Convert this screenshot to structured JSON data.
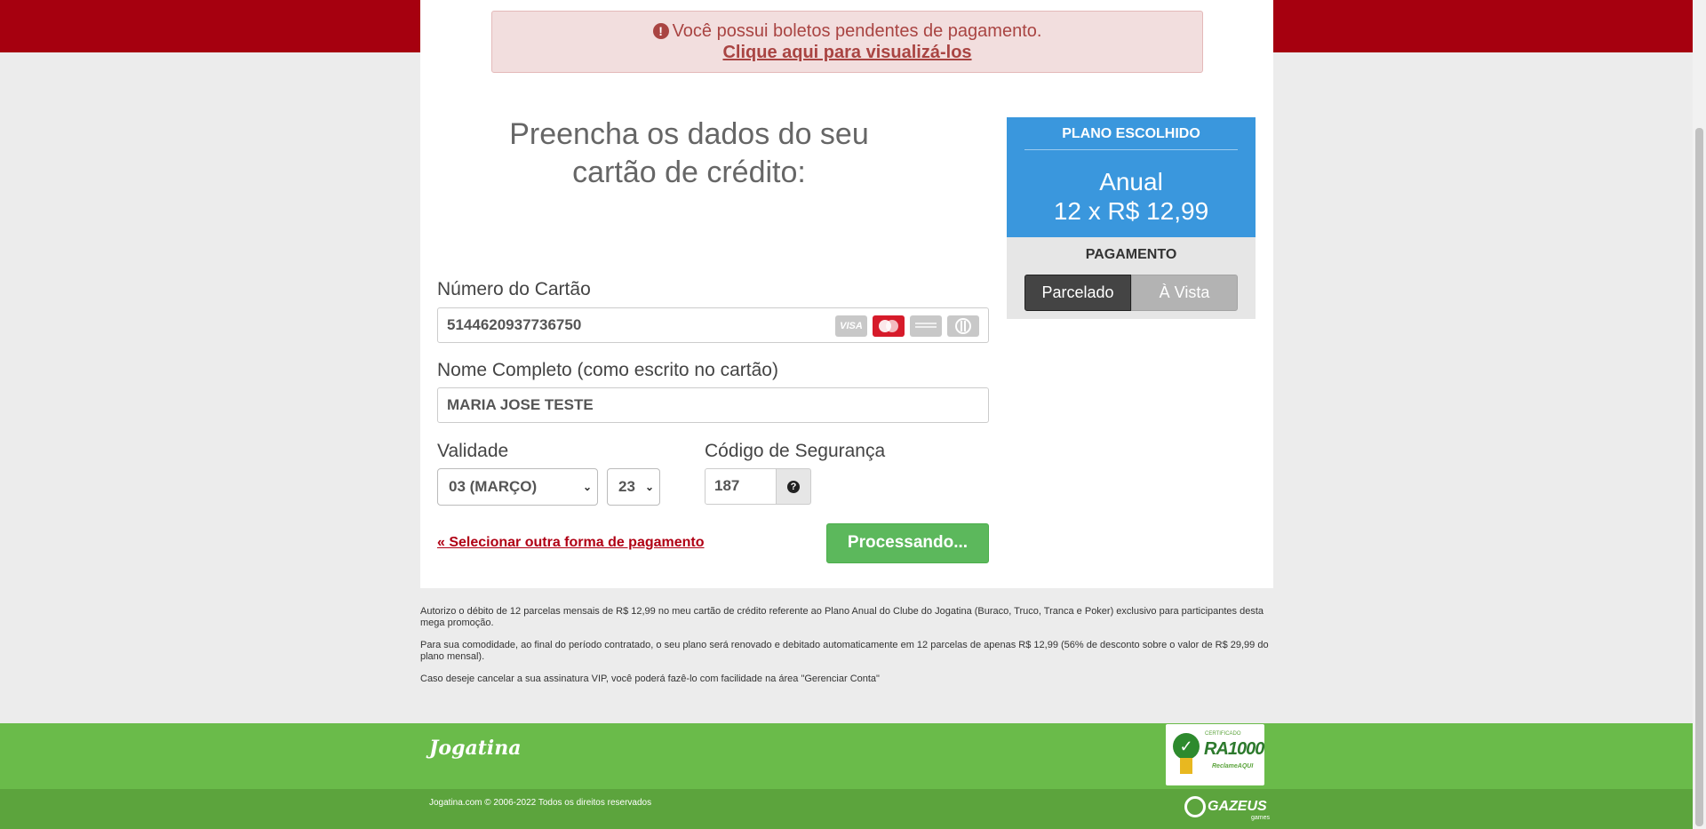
{
  "alert": {
    "message": "Você possui boletos pendentes de pagamento.",
    "link": "Clique aqui para visualizá-los"
  },
  "form": {
    "heading_line1": "Preencha os dados do seu",
    "heading_line2": "cartão de crédito:",
    "card_number_label": "Número do Cartão",
    "card_number_value": "5144620937736750",
    "name_label": "Nome Completo (como escrito no cartão)",
    "name_value": "MARIA JOSE TESTE",
    "validity_label": "Validade",
    "month_value": "03 (MARÇO)",
    "year_value": "23",
    "cvv_label": "Código de Segurança",
    "cvv_value": "187",
    "back_link": "« Selecionar outra forma de pagamento",
    "submit_label": "Processando..."
  },
  "card_brands": [
    "visa-icon",
    "mastercard-icon",
    "amex-icon",
    "diners-icon"
  ],
  "card_icons": {
    "visa": "VISA"
  },
  "plan": {
    "title": "PLANO ESCOLHIDO",
    "name": "Anual",
    "price": "12 x R$ 12,99",
    "payment_title": "PAGAMENTO",
    "option_installments": "Parcelado",
    "option_cash": "À Vista",
    "selected": "Parcelado"
  },
  "legal": {
    "p1": "Autorizo o débito de 12 parcelas mensais de R$ 12,99 no meu cartão de crédito referente ao Plano Anual do Clube do Jogatina (Buraco, Truco, Tranca e Poker) exclusivo para participantes desta mega promoção.",
    "p2": "Para sua comodidade, ao final do período contratado, o seu plano será renovado e debitado automaticamente em 12 parcelas de apenas R$ 12,99 (56% de desconto sobre o valor de R$ 29,99 do plano mensal).",
    "p3": "Caso deseje cancelar a sua assinatura VIP, você poderá fazê-lo com facilidade na área \"Gerenciar Conta\""
  },
  "footer": {
    "logo": "Jogatina",
    "copyright": "Jogatina.com © 2006-2022 Todos os direitos reservados",
    "badge_cert": "CERTIFICADO",
    "badge_ra": "RA1000",
    "badge_rec": "ReclameAQUI",
    "company": "GAZEUS",
    "company_sub": "games"
  },
  "colors": {
    "brand_red": "#a6000f",
    "plan_blue": "#3a97dd",
    "success_green": "#5cb85c",
    "footer_green": "#6abb4a"
  }
}
